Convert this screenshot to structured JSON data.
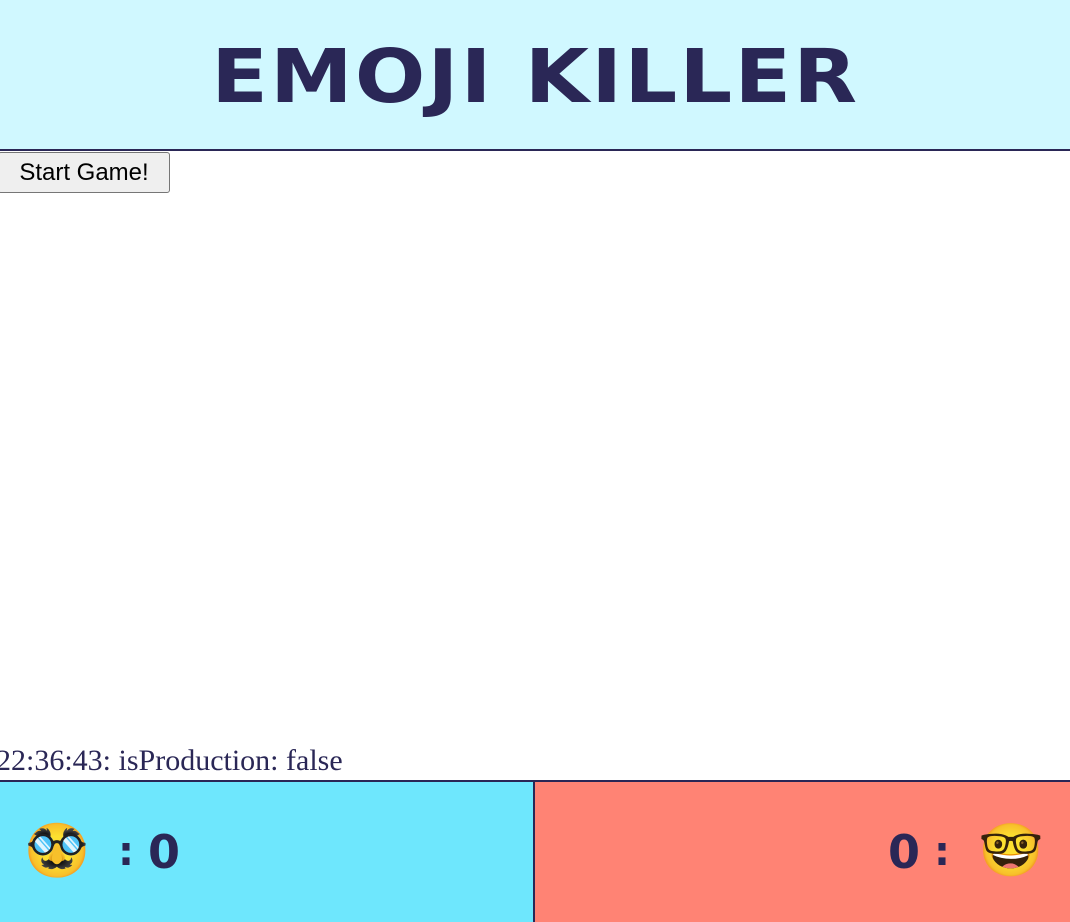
{
  "header": {
    "title": "EMOJI KILLER"
  },
  "controls": {
    "start_label": "Start Game!"
  },
  "log": {
    "time": "22:36:43",
    "message": "isProduction: false"
  },
  "players": [
    {
      "emoji": "🥸",
      "emoji_name": "disguised-face-icon",
      "score": "0",
      "color": "#6ee7fd"
    },
    {
      "emoji": "🤓",
      "emoji_name": "nerd-face-icon",
      "score": "0",
      "color": "#ff8374"
    }
  ],
  "theme": {
    "header_bg": "#d0f8ff",
    "text_color": "#2a2756"
  }
}
